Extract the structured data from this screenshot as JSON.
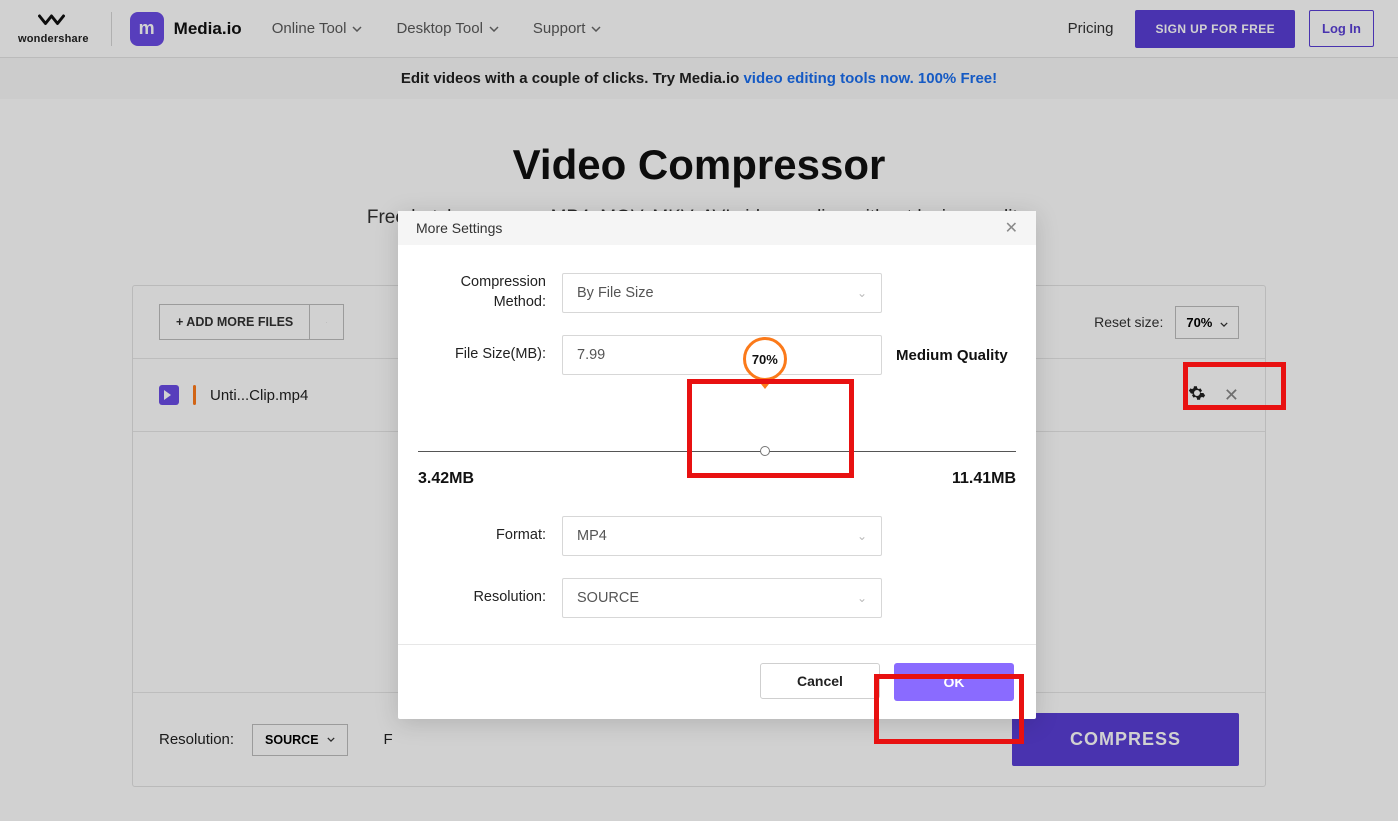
{
  "header": {
    "brand_sub": "wondershare",
    "product": "Media.io",
    "nav": {
      "online": "Online Tool",
      "desktop": "Desktop Tool",
      "support": "Support"
    },
    "pricing": "Pricing",
    "signup": "SIGN UP FOR FREE",
    "login": "Log In"
  },
  "promo": {
    "lead": "Edit videos with a couple of clicks. Try Media.io ",
    "link": "video editing tools now. 100% Free!"
  },
  "hero": {
    "title": "Video Compressor",
    "subtitle": "Free batch compress MP4, MOV, MKV, AVI videos online without losing quality."
  },
  "card": {
    "add_more": "+ ADD MORE FILES",
    "reset_label": "Reset size:",
    "reset_value": "70%",
    "file_row": {
      "name": "Unti...Clip.mp4"
    },
    "footer": {
      "resolution_label": "Resolution:",
      "resolution_value": "SOURCE",
      "format_label": "F",
      "compress": "COMPRESS"
    }
  },
  "modal": {
    "title": "More Settings",
    "labels": {
      "method": "Compression Method:",
      "size": "File Size(MB):",
      "format": "Format:",
      "resolution": "Resolution:"
    },
    "values": {
      "method": "By File Size",
      "size": "7.99",
      "format": "MP4",
      "resolution": "SOURCE"
    },
    "quality": "Medium Quality",
    "slider": {
      "percent": "70%",
      "position_pct": 58,
      "min_label": "3.42MB",
      "max_label": "11.41MB"
    },
    "buttons": {
      "cancel": "Cancel",
      "ok": "OK"
    }
  }
}
